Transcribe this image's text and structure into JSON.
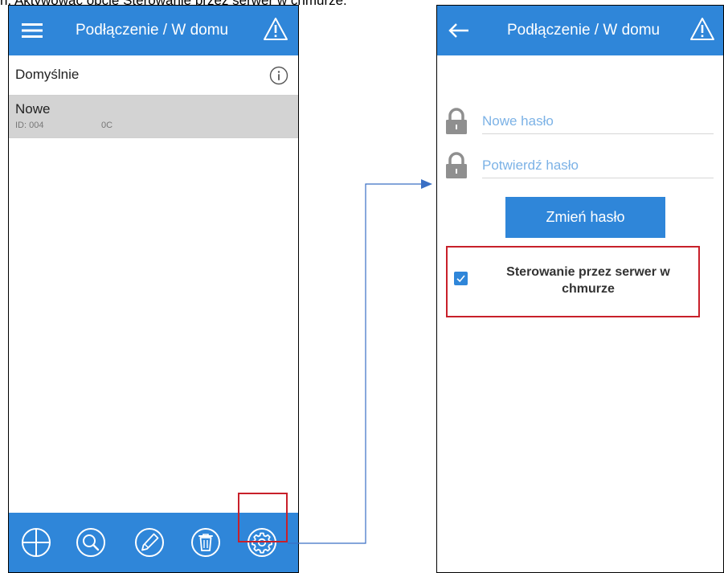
{
  "doc": {
    "heading": "n.  Aktywować opcję Sterowanie przez serwer w chmurze."
  },
  "left_screen": {
    "appbar": {
      "menu_icon": "hamburger-menu-icon",
      "title": "Podłączenie / W domu",
      "warning_icon": "warning-triangle-icon"
    },
    "list": [
      {
        "label": "Domyślnie",
        "info_icon": "info-circle-icon"
      },
      {
        "label": "Nowe",
        "sub": "ID: 004             0C",
        "selected": true
      }
    ],
    "toolbar": [
      {
        "icon": "add-circle-icon"
      },
      {
        "icon": "search-icon"
      },
      {
        "icon": "edit-pencil-icon"
      },
      {
        "icon": "trash-icon"
      },
      {
        "icon": "settings-gear-icon",
        "highlighted": true
      }
    ]
  },
  "right_screen": {
    "appbar": {
      "back_icon": "back-arrow-icon",
      "title": "Podłączenie / W domu",
      "warning_icon": "warning-triangle-icon"
    },
    "fields": {
      "new_password": {
        "placeholder": "Nowe hasło",
        "value": "",
        "icon": "lock-icon"
      },
      "confirm_password": {
        "placeholder": "Potwierdź hasło",
        "value": "",
        "icon": "lock-icon"
      }
    },
    "change_button": "Zmień hasło",
    "cloud_control": {
      "label": "Sterowanie przez serwer w chmurze",
      "checked": true
    }
  },
  "colors": {
    "primary": "#2f86d9",
    "highlight": "#c8202a",
    "selected_row": "#d3d3d3",
    "placeholder": "#7cb2e6",
    "connector": "#3a6fc4"
  }
}
